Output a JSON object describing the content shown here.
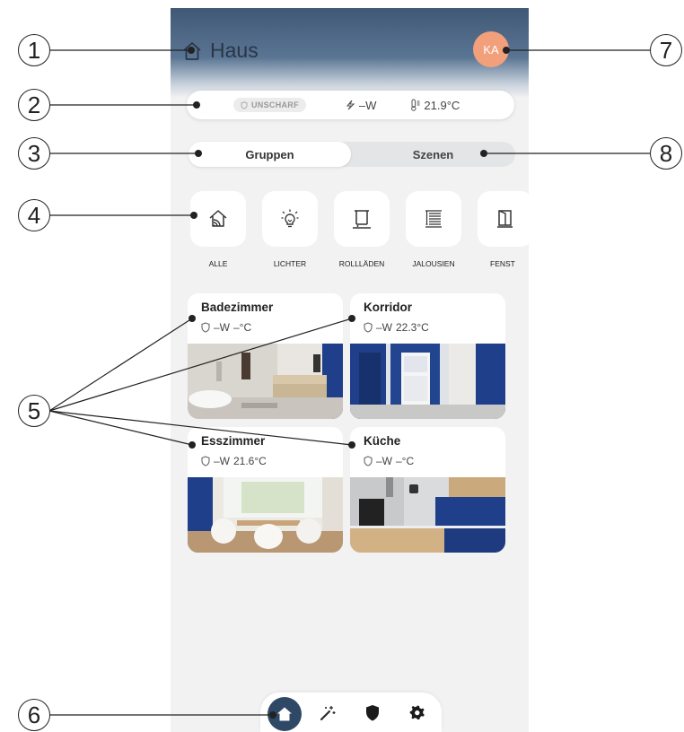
{
  "header": {
    "title": "Haus",
    "avatar_initials": "KA"
  },
  "status": {
    "alarm_badge": "UNSCHARF",
    "power": "–W",
    "temperature": "21.9°C"
  },
  "tabs": [
    {
      "label": "Gruppen",
      "active": true
    },
    {
      "label": "Szenen",
      "active": false
    }
  ],
  "categories": [
    {
      "label": "ALLE",
      "icon": "home-wifi-icon"
    },
    {
      "label": "LICHTER",
      "icon": "lightbulb-icon"
    },
    {
      "label": "ROLLLÄDEN",
      "icon": "roller-shutter-icon"
    },
    {
      "label": "JALOUSIEN",
      "icon": "blinds-icon"
    },
    {
      "label": "FENST",
      "icon": "window-icon"
    }
  ],
  "rooms": [
    {
      "name": "Badezimmer",
      "power": "–W",
      "temperature": "–°C"
    },
    {
      "name": "Korridor",
      "power": "–W",
      "temperature": "22.3°C"
    },
    {
      "name": "Esszimmer",
      "power": "–W",
      "temperature": "21.6°C"
    },
    {
      "name": "Küche",
      "power": "–W",
      "temperature": "–°C"
    }
  ],
  "bottom_nav": [
    {
      "icon": "home-icon",
      "active": true
    },
    {
      "icon": "magic-wand-icon",
      "active": false
    },
    {
      "icon": "shield-icon",
      "active": false
    },
    {
      "icon": "gear-icon",
      "active": false
    }
  ],
  "callouts": [
    "1",
    "2",
    "3",
    "4",
    "5",
    "6",
    "7",
    "8"
  ],
  "colors": {
    "header_blue": "#3f5876",
    "avatar": "#f2a07b",
    "nav_active": "#2e4866",
    "accent_blue": "#1f3f8a"
  }
}
